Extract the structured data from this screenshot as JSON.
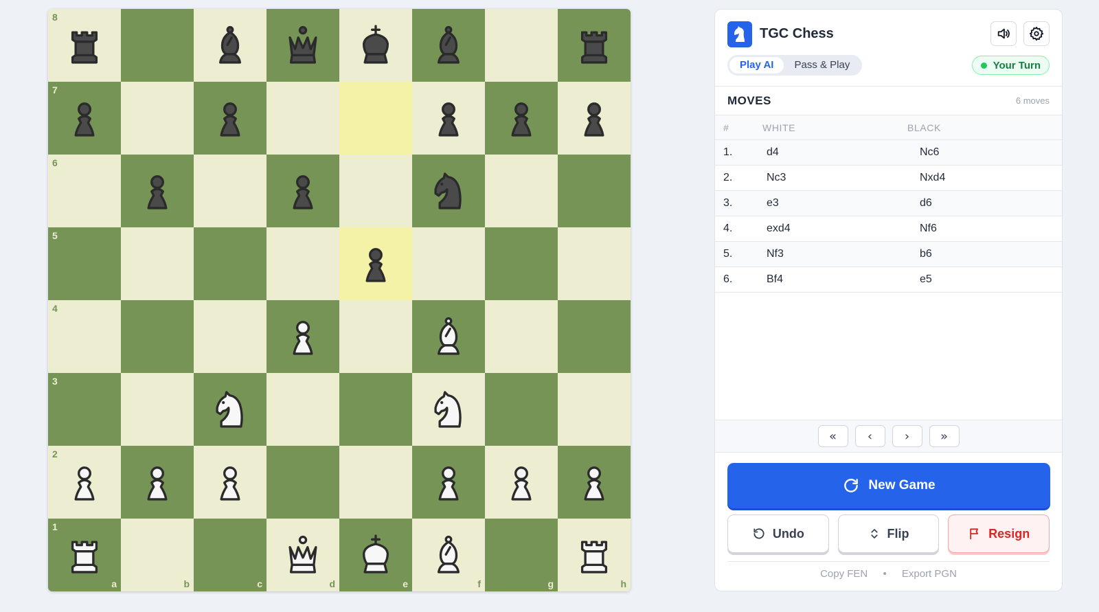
{
  "app": {
    "title": "TGC Chess"
  },
  "mode_tabs": [
    {
      "label": "Play AI",
      "active": true
    },
    {
      "label": "Pass & Play",
      "active": false
    }
  ],
  "status": {
    "turn_label": "Your Turn"
  },
  "moves": {
    "title": "MOVES",
    "count_label": "6 moves",
    "columns": [
      "#",
      "WHITE",
      "BLACK"
    ],
    "rows": [
      {
        "n": "1.",
        "white": "d4",
        "black": "Nc6"
      },
      {
        "n": "2.",
        "white": "Nc3",
        "black": "Nxd4"
      },
      {
        "n": "3.",
        "white": "e3",
        "black": "d6"
      },
      {
        "n": "4.",
        "white": "exd4",
        "black": "Nf6"
      },
      {
        "n": "5.",
        "white": "Nf3",
        "black": "b6"
      },
      {
        "n": "6.",
        "white": "Bf4",
        "black": "e5"
      }
    ]
  },
  "nav": {
    "first": "«",
    "prev": "‹",
    "next": "›",
    "last": "»"
  },
  "actions": {
    "new_game": "New Game",
    "undo": "Undo",
    "flip": "Flip",
    "resign": "Resign"
  },
  "footer": {
    "copy_fen": "Copy FEN",
    "separator": "•",
    "export_pgn": "Export PGN"
  },
  "board": {
    "ranks": [
      "8",
      "7",
      "6",
      "5",
      "4",
      "3",
      "2",
      "1"
    ],
    "files": [
      "a",
      "b",
      "c",
      "d",
      "e",
      "f",
      "g",
      "h"
    ],
    "position": [
      [
        "br",
        "",
        "bb",
        "bq",
        "bk",
        "bb",
        "",
        "br"
      ],
      [
        "bp",
        "",
        "bp",
        "",
        "",
        "bp",
        "bp",
        "bp"
      ],
      [
        "",
        "bp",
        "",
        "bp",
        "",
        "bn",
        "",
        ""
      ],
      [
        "",
        "",
        "",
        "",
        "bp",
        "",
        "",
        ""
      ],
      [
        "",
        "",
        "",
        "wp",
        "",
        "wb",
        "",
        ""
      ],
      [
        "",
        "",
        "wn",
        "",
        "",
        "wn",
        "",
        ""
      ],
      [
        "wp",
        "wp",
        "wp",
        "",
        "",
        "wp",
        "wp",
        "wp"
      ],
      [
        "wr",
        "",
        "",
        "wq",
        "wk",
        "wb",
        "",
        "wr"
      ]
    ],
    "last_move_squares": [
      "e7",
      "e5"
    ],
    "colors": {
      "light": "#ededd2",
      "dark": "#759456",
      "highlight": "#f3f2a6"
    }
  },
  "colors": {
    "accent": "#2563eb",
    "success": "#15803d",
    "danger": "#dc2626"
  },
  "icons": {
    "logo": "knight-icon",
    "sound": "speaker-icon",
    "settings": "gear-icon",
    "new_game": "refresh-icon",
    "undo": "undo-icon",
    "flip": "flip-icon",
    "resign": "flag-icon"
  }
}
